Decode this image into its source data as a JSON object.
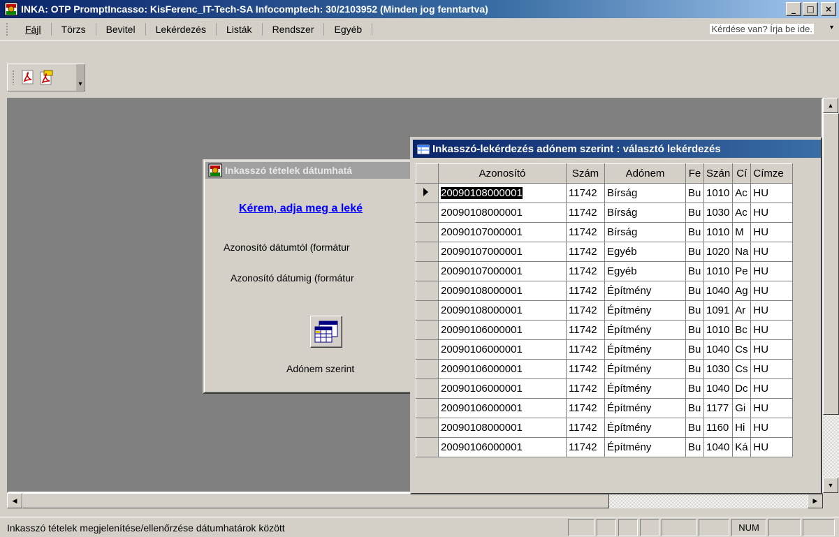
{
  "window": {
    "title": "INKA: OTP PromptIncasso: KisFerenc_IT-Tech-SA Infocomptech: 30/2103952 (Minden jog fenntartva)",
    "minimize": "_",
    "maximize": "□",
    "close": "×"
  },
  "menu": {
    "items": [
      "Fájl",
      "Törzs",
      "Bevitel",
      "Lekérdezés",
      "Listák",
      "Rendszer",
      "Egyéb"
    ],
    "help_placeholder": "Kérdése van? Írja be ide.",
    "help_drop": "▾"
  },
  "toolbar": {
    "pdf_icon": "pdf-icon",
    "pdf_export_icon": "pdf-export-icon",
    "more": "▾"
  },
  "dialog_date": {
    "title": "Inkasszó tételek dátumhatá",
    "prompt": "Kérem, adja meg a leké",
    "from_label": "Azonosító dátumtól (formátur",
    "to_label": "Azonosító dátumig (formátur",
    "button_label": "Adónem szerint",
    "button_icon": "datasheet-icon"
  },
  "datasheet": {
    "title": "Inkasszó-lekérdezés adónem szerint : választó lekérdezés",
    "columns": [
      "Azonosító",
      "Szám",
      "Adónem",
      "Fe",
      "Szán",
      "Cí",
      "Címze"
    ],
    "rows": [
      [
        "20090108000001",
        "11742",
        "Bírság",
        "Bu",
        "1010",
        "Ac",
        "HU"
      ],
      [
        "20090108000001",
        "11742",
        "Bírság",
        "Bu",
        "1030",
        "Ac",
        "HU"
      ],
      [
        "20090107000001",
        "11742",
        "Bírság",
        "Bu",
        "1010",
        "M",
        "HU"
      ],
      [
        "20090107000001",
        "11742",
        "Egyéb",
        "Bu",
        "1020",
        "Na",
        "HU"
      ],
      [
        "20090107000001",
        "11742",
        "Egyéb",
        "Bu",
        "1010",
        "Pe",
        "HU"
      ],
      [
        "20090108000001",
        "11742",
        "Építmény",
        "Bu",
        "1040",
        "Ag",
        "HU"
      ],
      [
        "20090108000001",
        "11742",
        "Építmény",
        "Bu",
        "1091",
        "Ar",
        "HU"
      ],
      [
        "20090106000001",
        "11742",
        "Építmény",
        "Bu",
        "1010",
        "Bc",
        "HU"
      ],
      [
        "20090106000001",
        "11742",
        "Építmény",
        "Bu",
        "1040",
        "Cs",
        "HU"
      ],
      [
        "20090106000001",
        "11742",
        "Építmény",
        "Bu",
        "1030",
        "Cs",
        "HU"
      ],
      [
        "20090106000001",
        "11742",
        "Építmény",
        "Bu",
        "1040",
        "Dc",
        "HU"
      ],
      [
        "20090106000001",
        "11742",
        "Építmény",
        "Bu",
        "1177",
        "Gi",
        "HU"
      ],
      [
        "20090108000001",
        "11742",
        "Építmény",
        "Bu",
        "1160",
        "Hi",
        "HU"
      ],
      [
        "20090106000001",
        "11742",
        "Építmény",
        "Bu",
        "1040",
        "Ká",
        "HU"
      ]
    ],
    "selected_row": 0
  },
  "status": {
    "text": "Inkasszó tételek megjelenítése/ellenőrzése dátumhatárok között",
    "num": "NUM"
  },
  "colors": {
    "title_active": "#0a246a",
    "title_inactive": "#a0a0a0",
    "link": "#0000ff",
    "workspace": "#808080"
  }
}
